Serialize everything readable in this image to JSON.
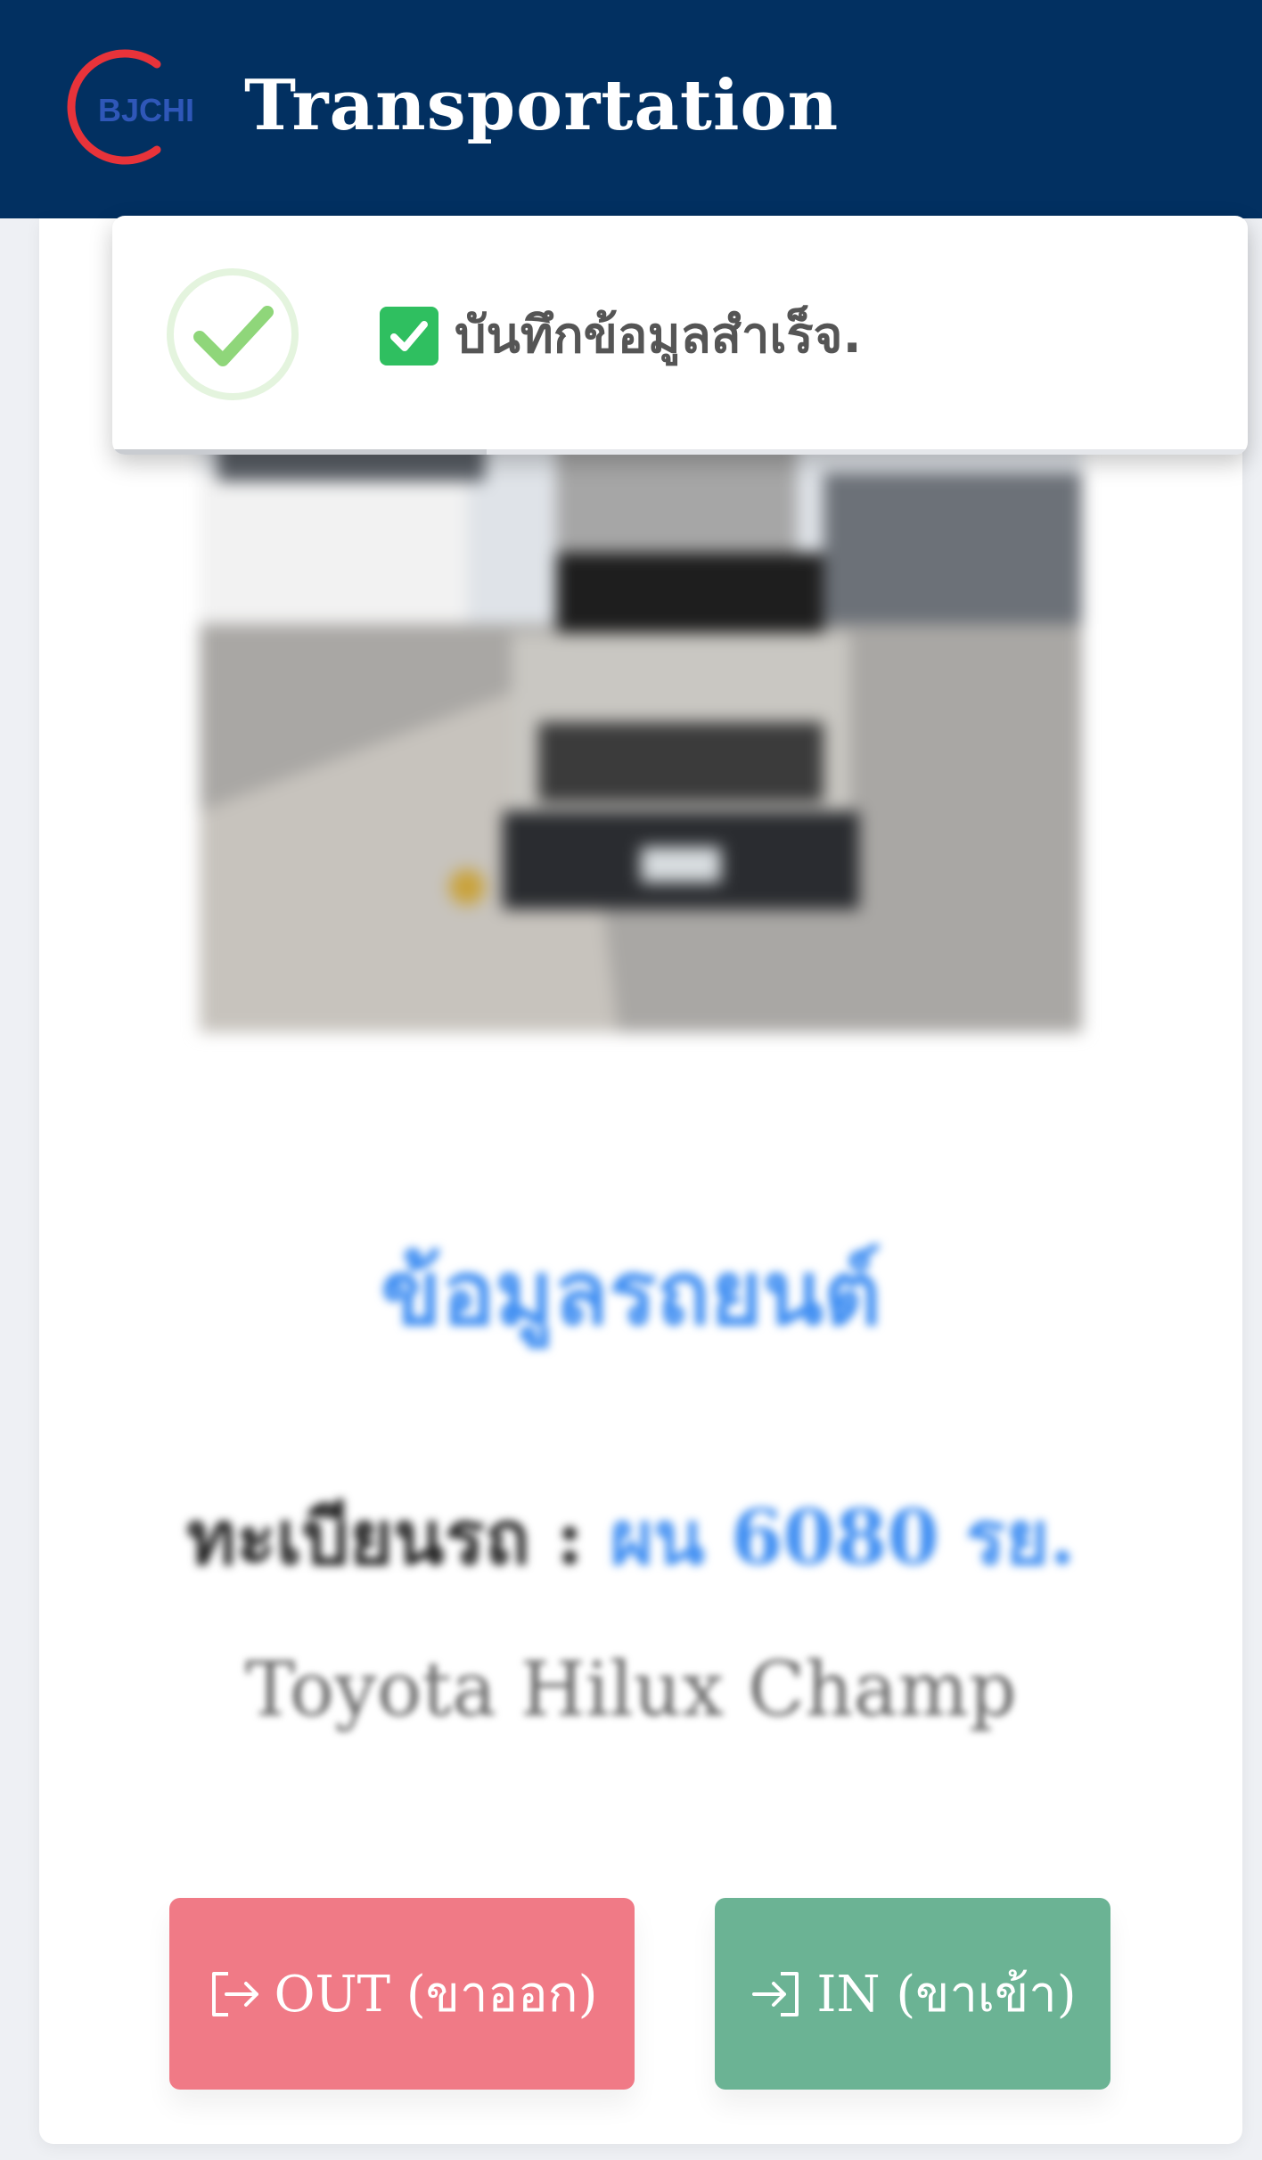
{
  "header": {
    "logo_text": "BJCHI",
    "title": "Transportation",
    "background": "#023061"
  },
  "toast": {
    "message": "บันทึกข้อมูลสำเร็จ.",
    "success_color": "#8fd67a",
    "progress_fraction": 0.33
  },
  "vehicle": {
    "section_title": "ข้อมูลรถยนต์",
    "plate_label": "ทะเบียนรถ :",
    "plate_value": "ผน 6080 รย.",
    "model": "Toyota Hilux Champ"
  },
  "actions": {
    "out_label": "OUT (ขาออก)",
    "in_label": "IN (ขาเข้า)",
    "out_color": "#f07a86",
    "in_color": "#6bb394",
    "out_icon": "sign-out-icon",
    "in_icon": "sign-in-icon"
  }
}
